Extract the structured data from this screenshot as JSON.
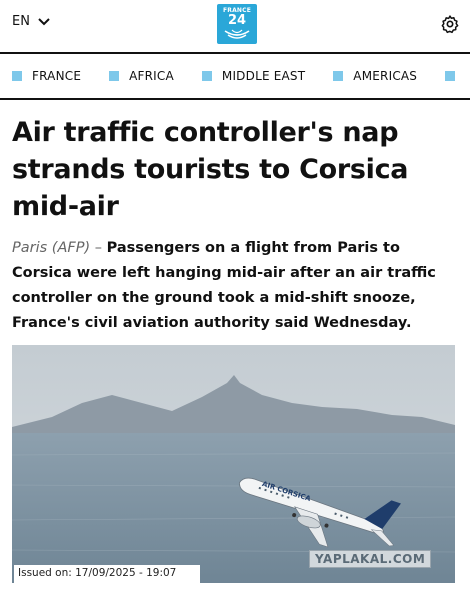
{
  "header": {
    "language": "EN",
    "logo_line1": "FRANCE",
    "logo_line2": "24",
    "brand_color": "#2aa7d8"
  },
  "nav": {
    "accent": "#7ec8ea",
    "items": [
      {
        "label": "FRANCE"
      },
      {
        "label": "AFRICA"
      },
      {
        "label": "MIDDLE EAST"
      },
      {
        "label": "AMERICAS"
      }
    ]
  },
  "article": {
    "headline": "Air traffic controller's nap strands tourists to Corsica mid-air",
    "dateline": "Paris (AFP)",
    "dash": " – ",
    "lead": "Passengers on a flight from Paris to Corsica were left hanging mid-air after an air traffic controller on the ground took a mid-shift snooze, France's civil aviation authority said Wednesday.",
    "image": {
      "plane_livery": "AIR CORSICA",
      "watermark": "YAPLAKAL.COM",
      "issued": "Issued on: 17/09/2025 - 19:07"
    }
  },
  "icons": {
    "language_dropdown": "chevron-down-icon",
    "settings": "gear-icon",
    "logo": "france24-logo"
  }
}
